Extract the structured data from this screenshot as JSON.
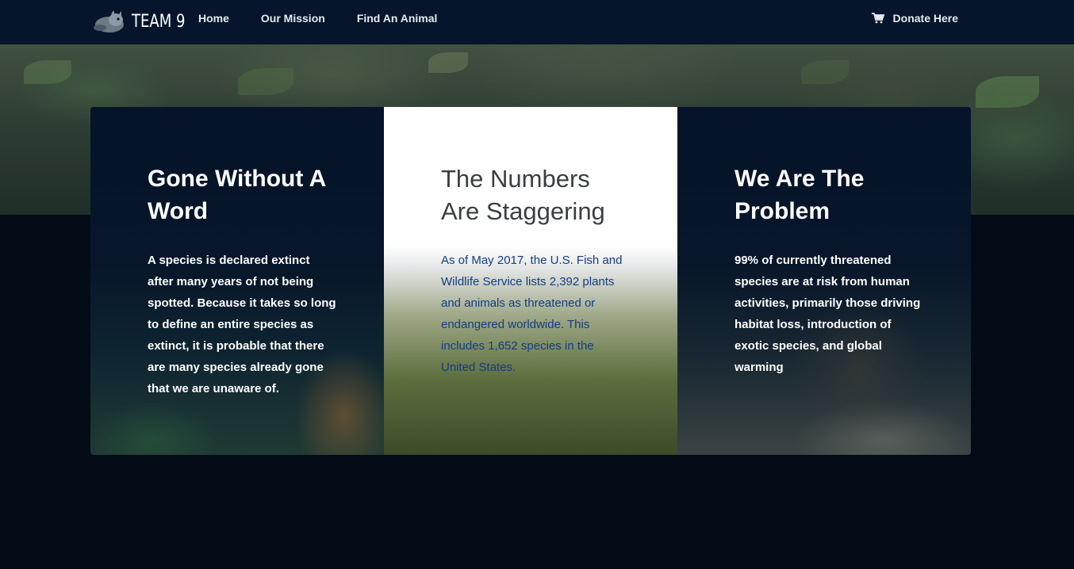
{
  "brand": {
    "name": "TEAM 9",
    "logo_icon": "red-panda-logo-icon"
  },
  "nav": {
    "links": [
      {
        "label": "Home"
      },
      {
        "label": "Our Mission"
      },
      {
        "label": "Find An Animal"
      }
    ],
    "donate": {
      "label": "Donate Here",
      "icon": "cart-icon"
    }
  },
  "cards": [
    {
      "title": "Gone Without A Word",
      "body": "A species is declared extinct after many years of not being spotted. Because it takes so long to define an entire species as extinct, it is probable that there are many species already gone that we are unaware of.",
      "theme": "dark",
      "image": "tiger"
    },
    {
      "title": "The Numbers Are Staggering",
      "body": "As of May 2017, the U.S. Fish and Wildlife Service lists 2,392 plants and animals as threatened or endangered worldwide. This includes 1,652 species in the United States.",
      "theme": "light",
      "image": "panda"
    },
    {
      "title": "We Are The Problem",
      "body": "99% of currently threatened species are at risk from human activities, primarily those driving habitat loss, introduction of exotic species, and global warming",
      "theme": "dark",
      "image": "otter"
    }
  ],
  "colors": {
    "navbar": "#06152c",
    "page_background": "#020b16",
    "card_dark": "#061329",
    "card_light_text": "#123e86"
  }
}
